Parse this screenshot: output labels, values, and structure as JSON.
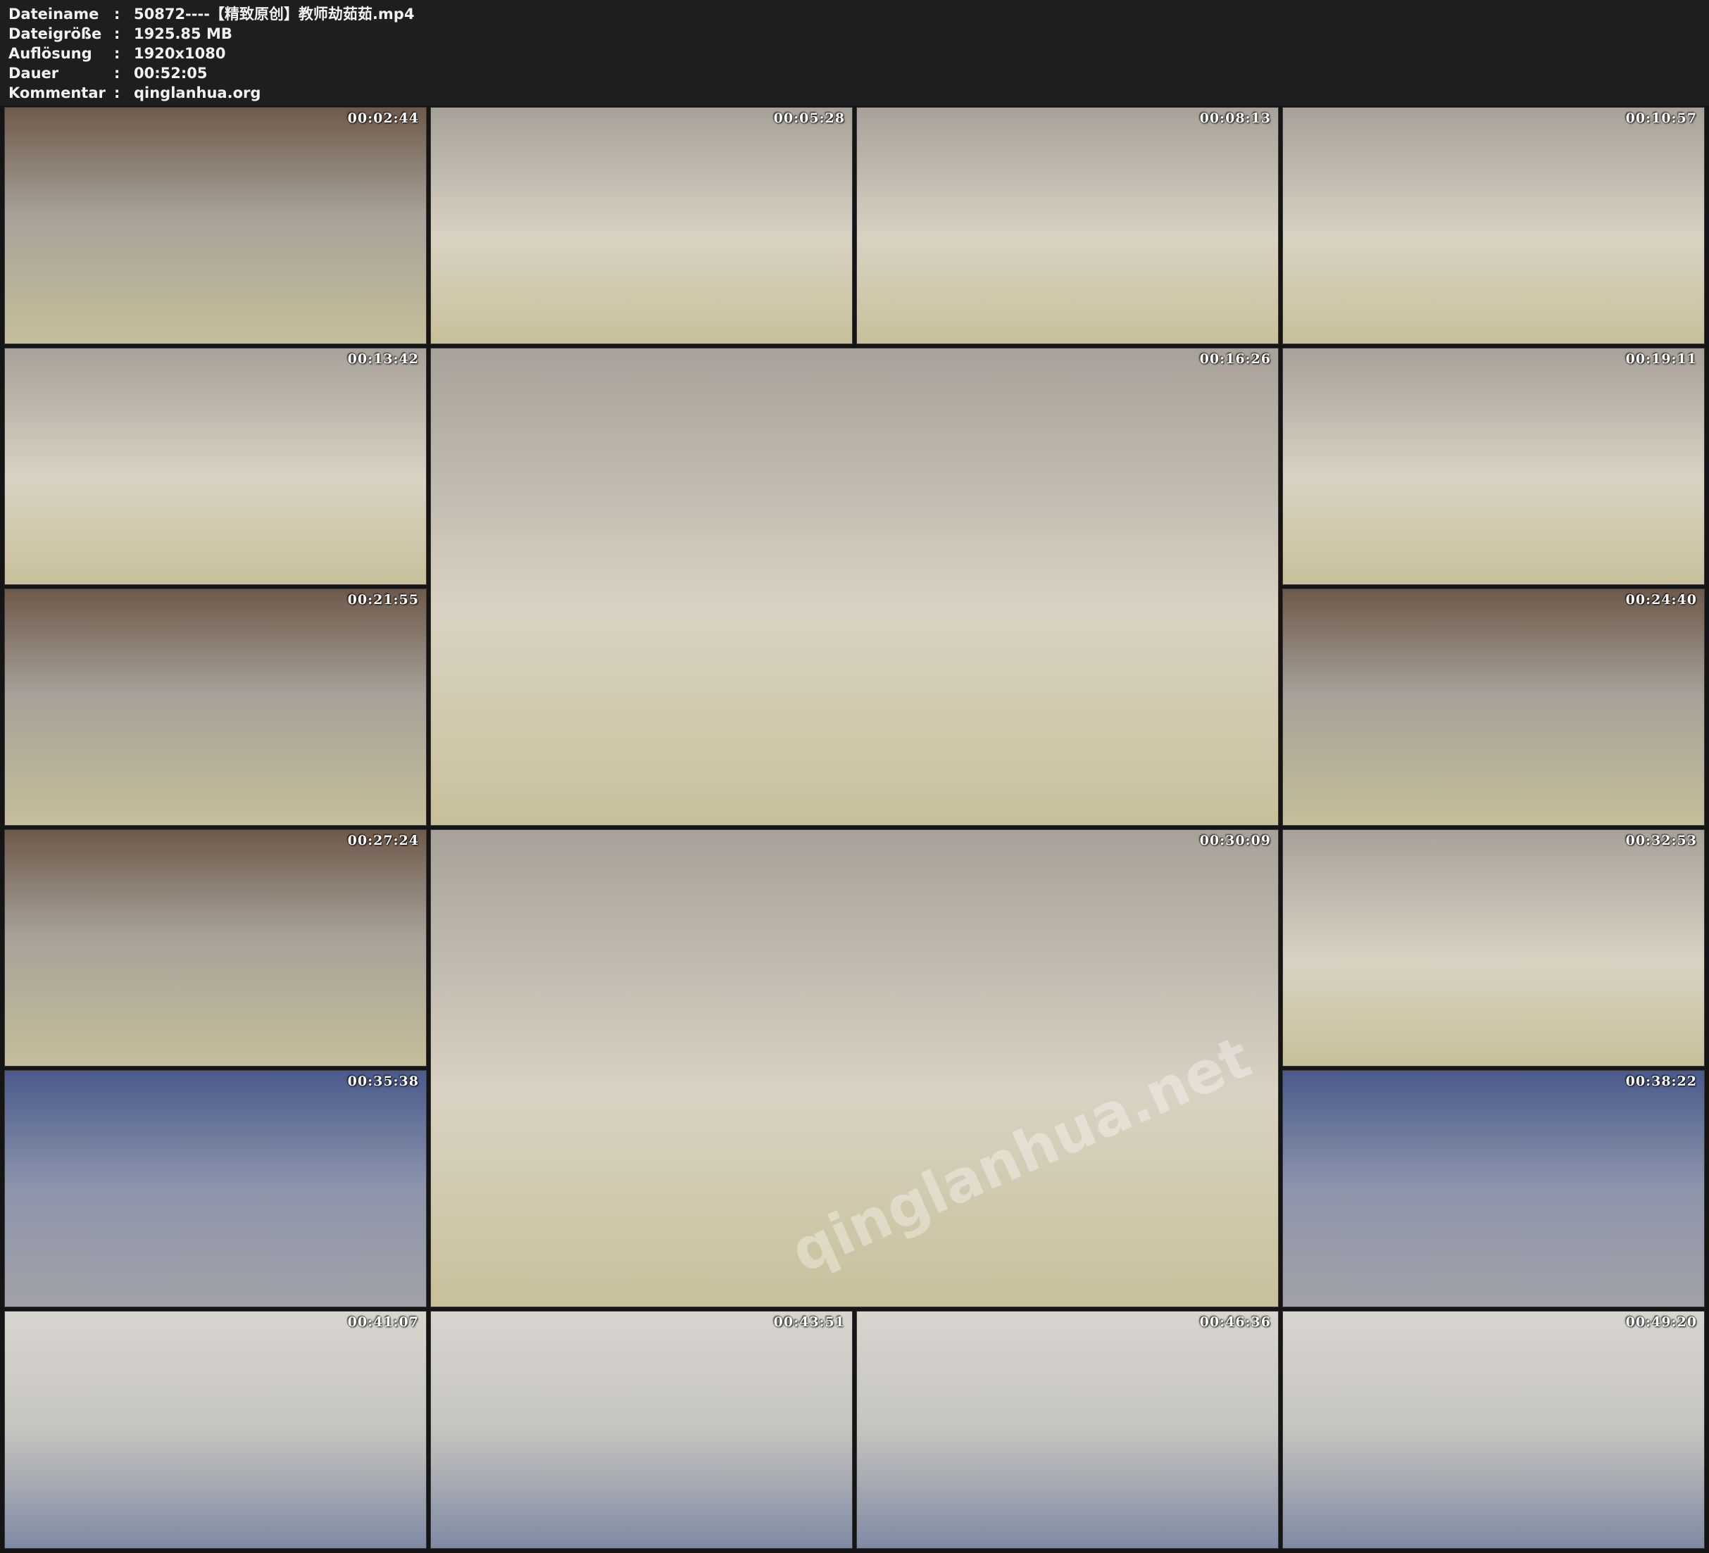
{
  "header": {
    "rows": [
      {
        "label": "Dateiname",
        "value": "50872----【精致原创】教师劫茹茹.mp4"
      },
      {
        "label": "Dateigröße",
        "value": "1925.85 MB"
      },
      {
        "label": "Auflösung",
        "value": "1920x1080"
      },
      {
        "label": "Dauer",
        "value": "00:52:05"
      },
      {
        "label": "Kommentar",
        "value": "qinglanhua.org"
      }
    ],
    "separator": ":"
  },
  "thumbnails": [
    {
      "timestamp": "00:02:44"
    },
    {
      "timestamp": "00:05:28"
    },
    {
      "timestamp": "00:08:13"
    },
    {
      "timestamp": "00:10:57"
    },
    {
      "timestamp": "00:13:42"
    },
    {
      "timestamp": "00:16:26"
    },
    {
      "timestamp": "00:19:11"
    },
    {
      "timestamp": "00:21:55"
    },
    {
      "timestamp": "00:24:40"
    },
    {
      "timestamp": "00:27:24"
    },
    {
      "timestamp": "00:30:09"
    },
    {
      "timestamp": "00:32:53"
    },
    {
      "timestamp": "00:35:38"
    },
    {
      "timestamp": "00:38:22"
    },
    {
      "timestamp": "00:41:07"
    },
    {
      "timestamp": "00:43:51"
    },
    {
      "timestamp": "00:46:36"
    },
    {
      "timestamp": "00:49:20"
    }
  ],
  "watermark": "qinglanhua.net"
}
